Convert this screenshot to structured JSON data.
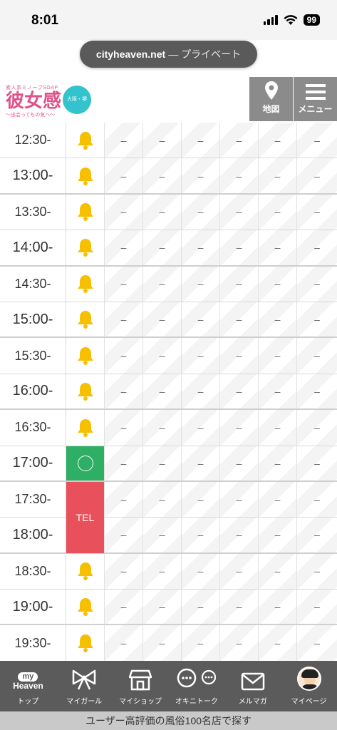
{
  "status_bar": {
    "time": "8:01",
    "battery": "99"
  },
  "browser": {
    "host": "cityheaven.net",
    "mode": "— プライベート"
  },
  "header": {
    "logo_small": "素人系ミノーブSOAP",
    "logo_main": "彼女感",
    "logo_sub": "〜出会ってもの気へ〜",
    "logo_badge": "大阪・堺",
    "map_label": "地図",
    "menu_label": "メニュー"
  },
  "schedule": {
    "rows": [
      {
        "time": "12:30-",
        "hour": false,
        "status": "bell"
      },
      {
        "time": "13:00-",
        "hour": true,
        "status": "bell"
      },
      {
        "time": "13:30-",
        "hour": false,
        "status": "bell"
      },
      {
        "time": "14:00-",
        "hour": true,
        "status": "bell"
      },
      {
        "time": "14:30-",
        "hour": false,
        "status": "bell"
      },
      {
        "time": "15:00-",
        "hour": true,
        "status": "bell"
      },
      {
        "time": "15:30-",
        "hour": false,
        "status": "bell"
      },
      {
        "time": "16:00-",
        "hour": true,
        "status": "bell"
      },
      {
        "time": "16:30-",
        "hour": false,
        "status": "bell"
      },
      {
        "time": "17:00-",
        "hour": true,
        "status": "available"
      },
      {
        "time": "17:30-",
        "hour": false,
        "status": "tel"
      },
      {
        "time": "18:00-",
        "hour": true,
        "status": "tel"
      },
      {
        "time": "18:30-",
        "hour": false,
        "status": "bell"
      },
      {
        "time": "19:00-",
        "hour": true,
        "status": "bell"
      },
      {
        "time": "19:30-",
        "hour": false,
        "status": "bell"
      }
    ],
    "empty_mark": "–",
    "tel_label": "TEL",
    "other_days": 6
  },
  "bottom_nav": {
    "top_label": "トップ",
    "mygirl_label": "マイガール",
    "myshop_label": "マイショップ",
    "okini_label": "オキニトーク",
    "mailmag_label": "メルマガ",
    "mypage_label": "マイページ",
    "myheaven_my": "my",
    "myheaven_word": "Heaven"
  },
  "footer": {
    "text": "ユーザー高評価の風俗100名店で探す"
  },
  "colors": {
    "bell": "#f6c000",
    "available": "#2fae66",
    "tel": "#e8505b",
    "nav_bg": "#5b5b5b"
  }
}
